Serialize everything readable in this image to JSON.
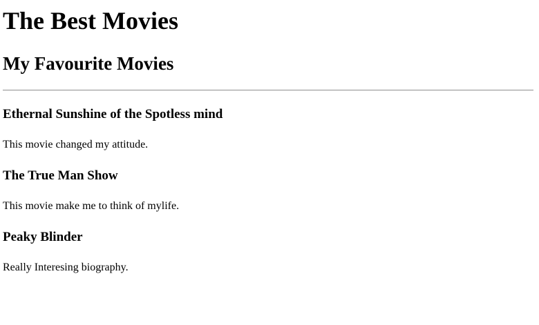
{
  "page": {
    "title": "The Best Movies",
    "subtitle": "My Favourite Movies"
  },
  "movies": [
    {
      "title": "Ethernal Sunshine of the Spotless mind",
      "description": "This movie changed my attitude."
    },
    {
      "title": "The True Man Show",
      "description": "This movie make me to think of mylife."
    },
    {
      "title": "Peaky Blinder",
      "description": "Really Interesing biography."
    }
  ]
}
